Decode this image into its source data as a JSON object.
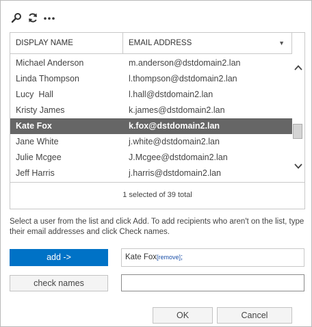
{
  "toolbar": {
    "icons": [
      "search-icon",
      "refresh-icon",
      "more-options-icon"
    ]
  },
  "grid": {
    "columns": {
      "name": "DISPLAY NAME",
      "email": "EMAIL ADDRESS"
    },
    "rows": [
      {
        "name": "Michael Anderson",
        "email": "m.anderson@dstdomain2.lan"
      },
      {
        "name": "Linda Thompson",
        "email": "l.thompson@dstdomain2.lan"
      },
      {
        "name": "Lucy  Hall",
        "email": "l.hall@dstdomain2.lan"
      },
      {
        "name": "Kristy James",
        "email": "k.james@dstdomain2.lan"
      },
      {
        "name": "Kate Fox",
        "email": "k.fox@dstdomain2.lan",
        "selected": true
      },
      {
        "name": "Jane White",
        "email": "j.white@dstdomain2.lan"
      },
      {
        "name": "Julie Mcgee",
        "email": "J.Mcgee@dstdomain2.lan"
      },
      {
        "name": "Jeff Harris",
        "email": "j.harris@dstdomain2.lan"
      }
    ],
    "status": "1 selected of 39 total"
  },
  "instructions": "Select a user from the list and click Add. To add recipients who aren't on the list, type their email addresses and click Check names.",
  "buttons": {
    "add": "add ->",
    "check_names": "check names",
    "ok": "OK",
    "cancel": "Cancel"
  },
  "recipients": {
    "name": "Kate Fox",
    "remove_label": "[remove]",
    "separator": ";"
  },
  "check_names_input": {
    "value": "",
    "placeholder": ""
  },
  "colors": {
    "accent": "#0072c6",
    "selected_row": "#666666"
  }
}
